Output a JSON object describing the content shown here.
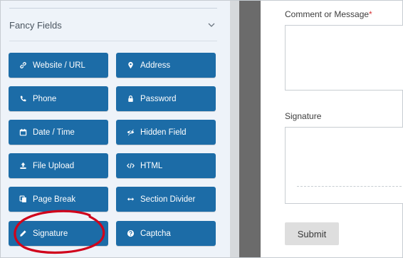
{
  "panel": {
    "title": "Fancy Fields",
    "toggle_icon": "chevron-down-icon"
  },
  "fields": [
    {
      "label": "Website / URL",
      "icon": "link-icon"
    },
    {
      "label": "Address",
      "icon": "map-pin-icon"
    },
    {
      "label": "Phone",
      "icon": "phone-icon"
    },
    {
      "label": "Password",
      "icon": "lock-icon"
    },
    {
      "label": "Date / Time",
      "icon": "calendar-icon"
    },
    {
      "label": "Hidden Field",
      "icon": "eye-slash-icon"
    },
    {
      "label": "File Upload",
      "icon": "upload-icon"
    },
    {
      "label": "HTML",
      "icon": "code-icon"
    },
    {
      "label": "Page Break",
      "icon": "copy-icon"
    },
    {
      "label": "Section Divider",
      "icon": "arrows-h-icon"
    },
    {
      "label": "Signature",
      "icon": "pen-icon"
    },
    {
      "label": "Captcha",
      "icon": "question-circle-icon"
    }
  ],
  "form": {
    "comment_label": "Comment or Message",
    "required_mark": "*",
    "signature_label": "Signature",
    "submit_label": "Submit"
  },
  "colors": {
    "field_button": "#1c6ca7",
    "panel_bg": "#eef3f9",
    "annotation": "#d0021b",
    "required": "#d63638"
  }
}
